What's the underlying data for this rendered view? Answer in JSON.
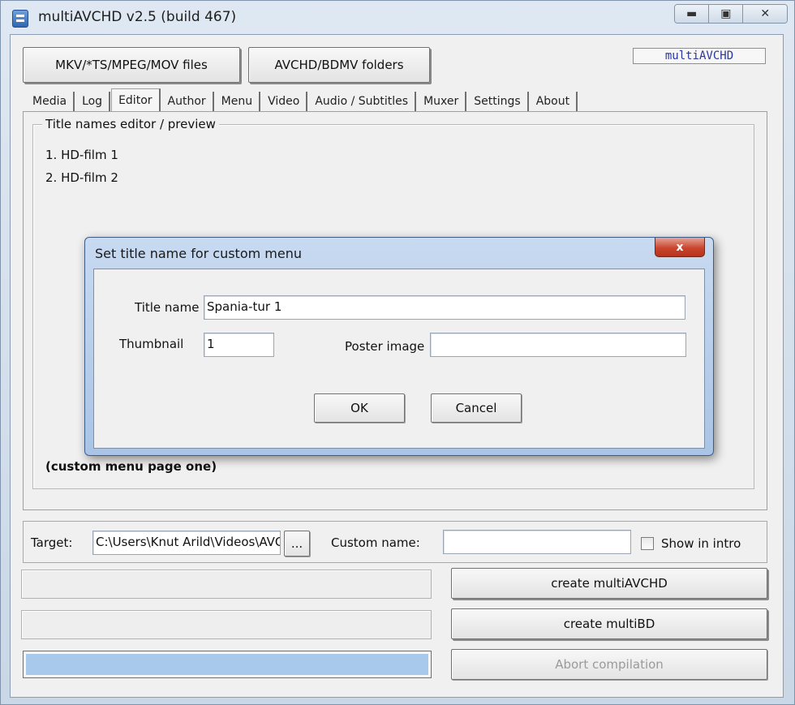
{
  "window": {
    "title": "multiAVCHD v2.5 (build 467)",
    "icon": "app-icon"
  },
  "source_buttons": {
    "files": "MKV/*TS/MPEG/MOV files",
    "folders": "AVCHD/BDMV folders"
  },
  "brand": "multiAVCHD",
  "tabs": [
    "Media",
    "Log",
    "Editor",
    "Author",
    "Menu",
    "Video",
    "Audio / Subtitles",
    "Muxer",
    "Settings",
    "About"
  ],
  "active_tab": "Editor",
  "editor": {
    "group_title": "Title names editor / preview",
    "titles": [
      "1. HD-film 1",
      "2. HD-film 2"
    ],
    "page_label": "(custom menu page one)"
  },
  "dialog": {
    "title": "Set title name for custom menu",
    "close_label": "x",
    "title_name_label": "Title name",
    "title_name_value": "Spania-tur 1",
    "thumbnail_label": "Thumbnail",
    "thumbnail_value": "1",
    "poster_label": "Poster image",
    "poster_value": "",
    "ok": "OK",
    "cancel": "Cancel"
  },
  "output": {
    "target_label": "Target:",
    "target_value": "C:\\Users\\Knut Arild\\Videos\\AVC",
    "browse_label": "...",
    "custom_name_label": "Custom name:",
    "custom_name_value": "",
    "show_in_intro_label": "Show in intro",
    "show_in_intro_checked": false
  },
  "actions": {
    "create_multiavchd": "create multiAVCHD",
    "create_multibd": "create multiBD",
    "abort": "Abort compilation"
  },
  "progress_fraction": 1.0,
  "colors": {
    "progress_fill": "#a9c9ec",
    "brand_text": "#2a36a0",
    "dialog_close": "#c9462f"
  }
}
